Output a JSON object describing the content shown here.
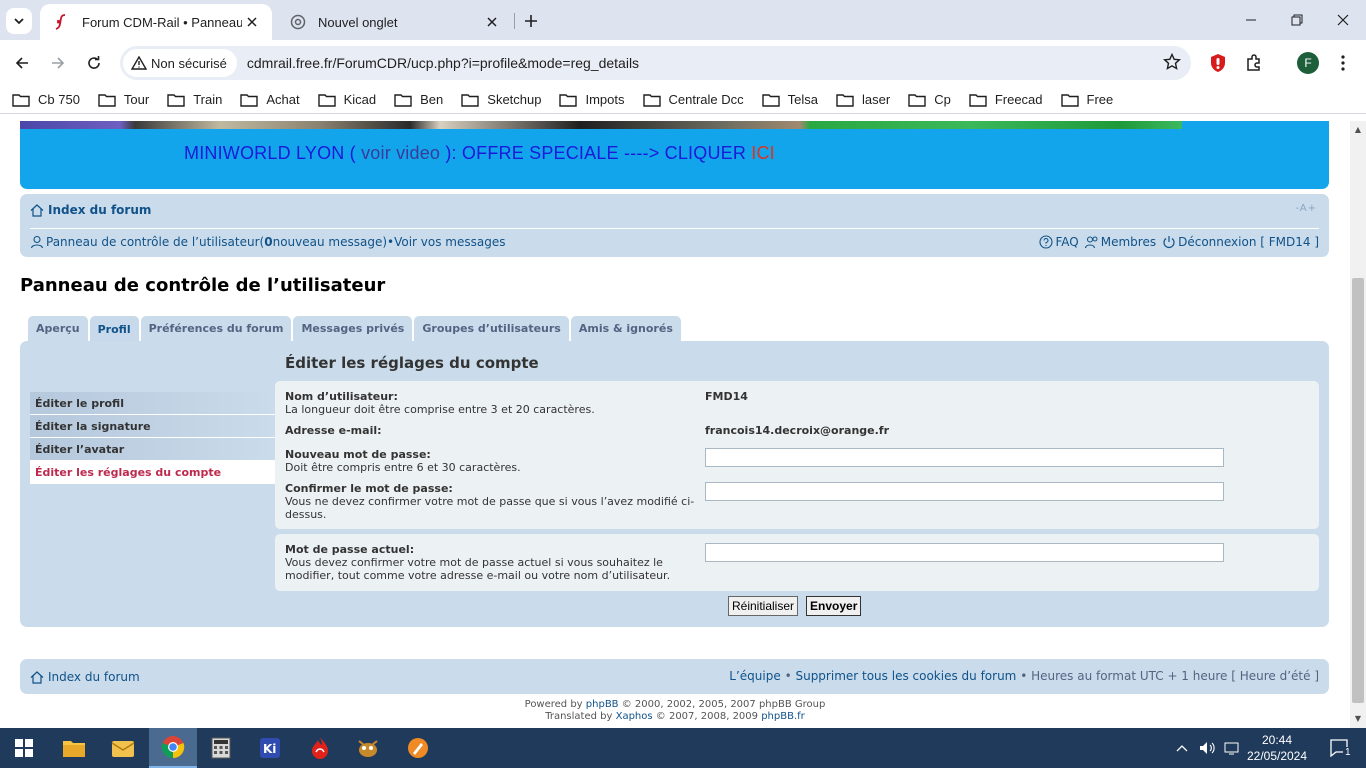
{
  "browser": {
    "tabs": [
      {
        "title": "Forum CDM-Rail • Panneau de",
        "active": true
      },
      {
        "title": "Nouvel onglet",
        "active": false
      }
    ],
    "security_label": "Non sécurisé",
    "url": "cdmrail.free.fr/ForumCDR/ucp.php?i=profile&mode=reg_details",
    "profile_initial": "F",
    "bookmarks": [
      "Cb 750",
      "Tour",
      "Train",
      "Achat",
      "Kicad",
      "Ben",
      "Sketchup",
      "Impots",
      "Centrale Dcc",
      "Telsa",
      "laser",
      "Cp",
      "Freecad",
      "Free"
    ]
  },
  "banner": {
    "part1": "MINIWORLD LYON ( ",
    "part2": "voir video",
    "part3": " ): OFFRE SPECIALE ----> CLIQUER ",
    "part4": "ICI"
  },
  "navbar": {
    "index": "Index du forum",
    "fontsize": "-A+",
    "ucp_link": "Panneau de contrôle de l’utilisateur",
    "ucp_open": " (",
    "new_count": "0",
    "new_label": " nouveau message)",
    "bullet": " • ",
    "view_messages": "Voir vos messages",
    "faq": "FAQ",
    "members": "Membres",
    "logout": "Déconnexion [ FMD14 ]"
  },
  "page_title": "Panneau de contrôle de l’utilisateur",
  "tabs": [
    "Aperçu",
    "Profil",
    "Préférences du forum",
    "Messages privés",
    "Groupes d’utilisateurs",
    "Amis & ignorés"
  ],
  "menu": [
    "Éditer le profil",
    "Éditer la signature",
    "Éditer l’avatar",
    "Éditer les réglages du compte"
  ],
  "form": {
    "title": "Éditer les réglages du compte",
    "username_label": "Nom d’utilisateur:",
    "username_desc": "La longueur doit être comprise entre 3 et 20 caractères.",
    "username_value": "FMD14",
    "email_label": "Adresse e-mail:",
    "email_value": "francois14.decroix@orange.fr",
    "newpass_label": "Nouveau mot de passe:",
    "newpass_desc": "Doit être compris entre 6 et 30 caractères.",
    "confirm_label": "Confirmer le mot de passe:",
    "confirm_desc": "Vous ne devez confirmer votre mot de passe que si vous l’avez modifié ci-dessus.",
    "current_label": "Mot de passe actuel:",
    "current_desc": "Vous devez confirmer votre mot de passe actuel si vous souhaitez le modifier, tout comme votre adresse e-mail ou votre nom d’utilisateur.",
    "reset_label": "Réinitialiser",
    "submit_label": "Envoyer"
  },
  "footer": {
    "index": "Index du forum",
    "team": "L’équipe",
    "bullet": " • ",
    "delete_cookies": "Supprimer tous les cookies du forum",
    "timezone": " • Heures au format UTC + 1 heure [ Heure d’été ]",
    "powered_prefix": "Powered by ",
    "phpbb": "phpBB",
    "powered_suffix": " © 2000, 2002, 2005, 2007 phpBB Group",
    "translated_prefix": "Translated by ",
    "xaphos": "Xaphos",
    "translated_mid": " © 2007, 2008, 2009 ",
    "phpbbfr": "phpBB.fr"
  },
  "taskbar": {
    "time": "20:44",
    "date": "22/05/2024",
    "notification_count": "1"
  },
  "colors": {
    "phpbb_blue": "#105289",
    "panel_bg": "#cadceb",
    "banner_bg": "#12a5ec",
    "active_menu": "#bc2a4d"
  }
}
